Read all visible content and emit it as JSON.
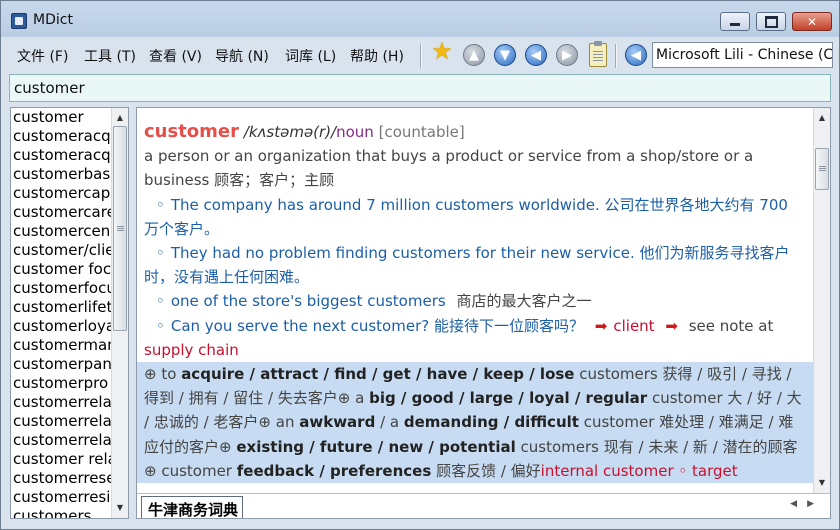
{
  "window": {
    "title": "MDict"
  },
  "menu": [
    "文件 (F)",
    "工具 (T)",
    "查看 (V)",
    "导航 (N)",
    "词库 (L)",
    "帮助 (H)"
  ],
  "toolbar": {
    "icons": [
      "star-icon",
      "up-arrow-icon",
      "down-arrow-icon",
      "back-arrow-icon",
      "forward-arrow-icon",
      "clipboard-icon",
      "speaker-icon"
    ],
    "voice_selected": "Microsoft Lili - Chinese (C"
  },
  "search": {
    "value": "customer"
  },
  "wordlist": [
    "customer",
    "customeracq",
    "customeracq",
    "customerbas",
    "customercap",
    "customercare",
    "customercen",
    "customer/clie",
    "customer foc",
    "customerfocu",
    "customerlifet",
    "customerloya",
    "customerman",
    "customerpan",
    "customerpro",
    "customerrela",
    "customerrela",
    "customerrela",
    "customer rela",
    "customerrese",
    "customerresi",
    "customers"
  ],
  "entry": {
    "headword": "customer",
    "phonetic": "/kʌstəmə(r)/",
    "pos": "noun",
    "grammar": "[countable]",
    "definition": "a person or an organization that buys a product or service from a shop/store or a business",
    "definition_cn": "顾客；客户；主顾",
    "examples": [
      {
        "en": "The company has around 7 million customers worldwide.",
        "cn": "公司在世界各地大约有 700 万个客户。"
      },
      {
        "en": "They had no problem finding customers for their new service.",
        "cn": "他们为新服务寻找客户时，没有遇上任何困难。"
      },
      {
        "en": "one of the store's biggest customers",
        "cn": "商店的最大客户之一"
      }
    ],
    "example4_en": "Can you serve the next customer?",
    "example4_cn": "能接待下一位顾客吗？",
    "xref1": "client",
    "see_note": "see note at",
    "xref2": "supply chain",
    "collocations": {
      "c1_prefix": "⊕ to",
      "c1_bold": "acquire / attract / find / get / have / keep / lose",
      "c1_rest": "customers 获得 / 吸引 / 寻找 / 得到 / 拥有 / 留住 / 失去客户⊕ a",
      "c2_bold": "big / good / large / loyal / regular",
      "c2_rest": "customer 大 / 好 / 大 / 忠诚的 / 老客户⊕ an",
      "c3_bold": "awkward",
      "c3_mid": "/ a",
      "c4_bold": "demanding / difficult",
      "c4_rest": "customer 难处理 / 难满足 / 难应付的客户⊕",
      "c5_bold": "existing / future / new / potential",
      "c5_rest": "customers 现有 / 未来 / 新 / 潜在的顾客⊕ customer",
      "c6_bold": "feedback / preferences",
      "c6_rest": "顾客反馈 / 偏好",
      "link1": "internal customer",
      "link_sep": "◦",
      "link2": "target"
    }
  },
  "dictionary_tab": "牛津商务词典"
}
